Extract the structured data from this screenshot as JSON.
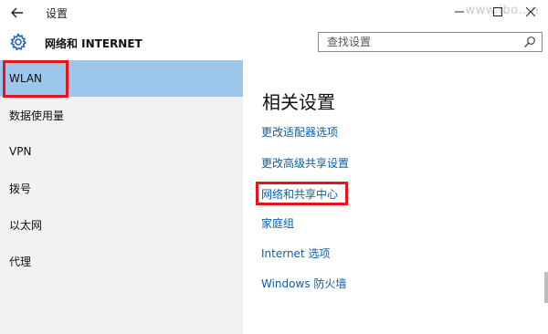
{
  "titlebar": {
    "title": "设置",
    "back_icon": "back-arrow-icon",
    "watermark": "www.ibo...n"
  },
  "header": {
    "icon": "gear-icon",
    "title": "网络和 INTERNET"
  },
  "search": {
    "placeholder": "查找设置",
    "icon": "search-icon"
  },
  "sidebar": {
    "items": [
      {
        "label": "WLAN",
        "active": true
      },
      {
        "label": "数据使用量",
        "active": false
      },
      {
        "label": "VPN",
        "active": false
      },
      {
        "label": "拨号",
        "active": false
      },
      {
        "label": "以太网",
        "active": false
      },
      {
        "label": "代理",
        "active": false
      }
    ]
  },
  "main": {
    "heading": "相关设置",
    "links": [
      {
        "label": "更改适配器选项"
      },
      {
        "label": "更改高级共享设置"
      },
      {
        "label": "网络和共享中心"
      },
      {
        "label": "家庭组"
      },
      {
        "label": "Internet 选项"
      },
      {
        "label": "Windows 防火墙"
      }
    ]
  },
  "colors": {
    "accent": "#0a5fa8",
    "selected_bg": "#9dc7ea",
    "sidebar_bg": "#f2f2f2",
    "annotation": "#e8141b"
  }
}
